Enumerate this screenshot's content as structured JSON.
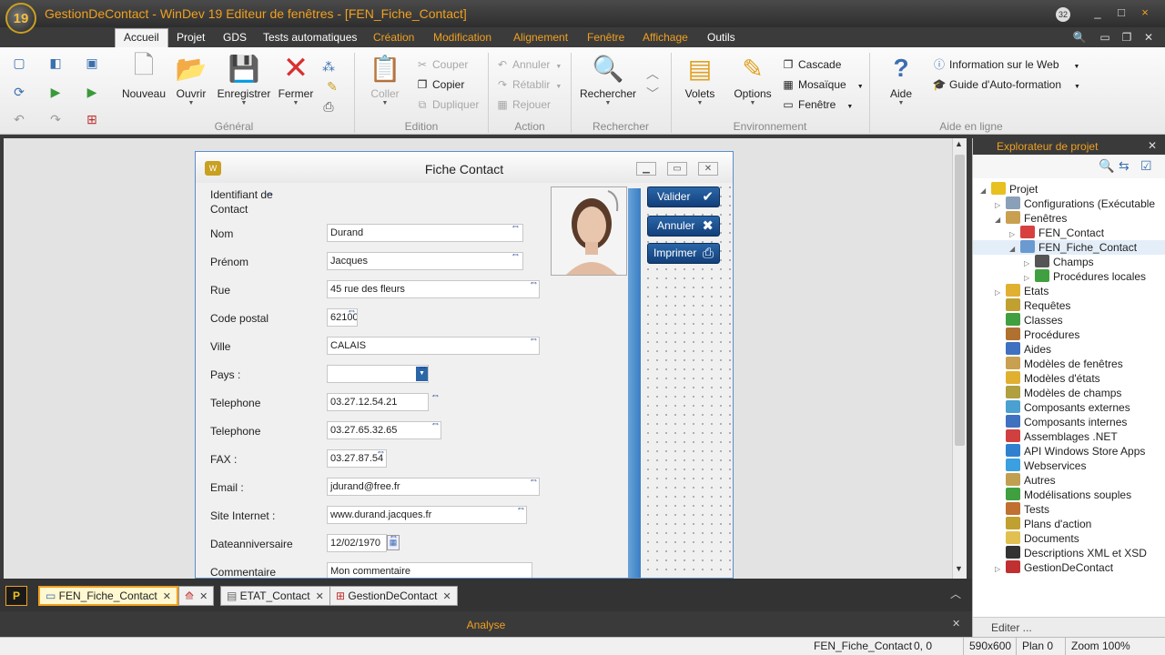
{
  "app": {
    "logo_text": "19",
    "title": "GestionDeContact - WinDev 19  Editeur de fenêtres - [FEN_Fiche_Contact]",
    "notif_count": "32",
    "win_controls": [
      "_",
      "□",
      "×"
    ]
  },
  "menu": {
    "items": [
      "Accueil",
      "Projet",
      "GDS",
      "Tests automatiques",
      "Création",
      "Modification",
      "Alignement",
      "Fenêtre",
      "Affichage",
      "Outils"
    ]
  },
  "ribbon": {
    "groups": [
      "Général",
      "Edition",
      "Action",
      "Rechercher",
      "Environnement",
      "Aide en ligne"
    ],
    "general": {
      "nouveau": "Nouveau",
      "ouvrir": "Ouvrir",
      "enregistrer": "Enregistrer",
      "fermer": "Fermer"
    },
    "edition": {
      "coller": "Coller",
      "couper": "Couper",
      "copier": "Copier",
      "dupliquer": "Dupliquer"
    },
    "action": {
      "annuler": "Annuler",
      "retablir": "Rétablir",
      "rejouer": "Rejouer"
    },
    "rechercher": {
      "label": "Rechercher"
    },
    "environnement": {
      "volets": "Volets",
      "options": "Options",
      "cascade": "Cascade",
      "mosaique": "Mosaïque",
      "fenetre": "Fenêtre"
    },
    "aide": {
      "aide": "Aide",
      "info_web": "Information sur le Web",
      "guide": "Guide d'Auto-formation"
    }
  },
  "form": {
    "title": "Fiche Contact",
    "fields": [
      {
        "label": "Identifiant de\nContact",
        "value": ""
      },
      {
        "label": "Nom",
        "value": "Durand"
      },
      {
        "label": "Prénom",
        "value": "Jacques"
      },
      {
        "label": "Rue",
        "value": "45 rue des fleurs"
      },
      {
        "label": "Code postal",
        "value": "62100"
      },
      {
        "label": "Ville",
        "value": "CALAIS"
      },
      {
        "label": "Pays :",
        "value": ""
      },
      {
        "label": "Telephone",
        "value": "03.27.12.54.21"
      },
      {
        "label": "Telephone",
        "value": "03.27.65.32.65"
      },
      {
        "label": "FAX :",
        "value": "03.27.87.54"
      },
      {
        "label": "Email :",
        "value": "jdurand@free.fr"
      },
      {
        "label": "Site Internet :",
        "value": "www.durand.jacques.fr"
      },
      {
        "label": "Dateanniversaire",
        "value": "12/02/1970"
      },
      {
        "label": "Commentaire",
        "value": "Mon commentaire"
      }
    ],
    "buttons": {
      "valider": "Valider",
      "annuler": "Annuler",
      "imprimer": "Imprimer"
    }
  },
  "project_explorer": {
    "title": "Explorateur de projet",
    "footer": "Editer ...",
    "tree": [
      {
        "label": "Projet",
        "depth": 0,
        "expanded": "open",
        "color": "#e8c020"
      },
      {
        "label": "Configurations (Exécutable",
        "depth": 1,
        "expanded": "closed",
        "color": "#8a9fb8"
      },
      {
        "label": "Fenêtres",
        "depth": 1,
        "expanded": "open",
        "color": "#c8a050"
      },
      {
        "label": "FEN_Contact",
        "depth": 2,
        "expanded": "closed",
        "color": "#d84040"
      },
      {
        "label": "FEN_Fiche_Contact",
        "depth": 2,
        "expanded": "open",
        "color": "#6a9ad0",
        "selected": true
      },
      {
        "label": "Champs",
        "depth": 3,
        "expanded": "closed",
        "color": "#555555"
      },
      {
        "label": "Procédures locales",
        "depth": 3,
        "expanded": "closed",
        "color": "#40a040"
      },
      {
        "label": "Etats",
        "depth": 1,
        "expanded": "closed",
        "color": "#e0b030"
      },
      {
        "label": "Requêtes",
        "depth": 1,
        "expanded": "",
        "color": "#c0a030"
      },
      {
        "label": "Classes",
        "depth": 1,
        "expanded": "",
        "color": "#40a040"
      },
      {
        "label": "Procédures",
        "depth": 1,
        "expanded": "",
        "color": "#b07030"
      },
      {
        "label": "Aides",
        "depth": 1,
        "expanded": "",
        "color": "#4070c0"
      },
      {
        "label": "Modèles de fenêtres",
        "depth": 1,
        "expanded": "",
        "color": "#c8a050"
      },
      {
        "label": "Modèles d'états",
        "depth": 1,
        "expanded": "",
        "color": "#e0b030"
      },
      {
        "label": "Modèles de champs",
        "depth": 1,
        "expanded": "",
        "color": "#b0a040"
      },
      {
        "label": "Composants externes",
        "depth": 1,
        "expanded": "",
        "color": "#4aa0d0"
      },
      {
        "label": "Composants internes",
        "depth": 1,
        "expanded": "",
        "color": "#4070c0"
      },
      {
        "label": "Assemblages .NET",
        "depth": 1,
        "expanded": "",
        "color": "#d04040"
      },
      {
        "label": "API Windows Store Apps",
        "depth": 1,
        "expanded": "",
        "color": "#3080d0"
      },
      {
        "label": "Webservices",
        "depth": 1,
        "expanded": "",
        "color": "#3aa0e0"
      },
      {
        "label": "Autres",
        "depth": 1,
        "expanded": "",
        "color": "#c0a050"
      },
      {
        "label": "Modélisations souples",
        "depth": 1,
        "expanded": "",
        "color": "#40a040"
      },
      {
        "label": "Tests",
        "depth": 1,
        "expanded": "",
        "color": "#c07030"
      },
      {
        "label": "Plans d'action",
        "depth": 1,
        "expanded": "",
        "color": "#c0a030"
      },
      {
        "label": "Documents",
        "depth": 1,
        "expanded": "",
        "color": "#e0c050"
      },
      {
        "label": "Descriptions XML et XSD",
        "depth": 1,
        "expanded": "",
        "color": "#333333"
      },
      {
        "label": "GestionDeContact",
        "depth": 1,
        "expanded": "closed",
        "color": "#c03030"
      }
    ]
  },
  "tabs": [
    {
      "label": "FEN_Fiche_Contact",
      "active": true
    },
    {
      "label": "",
      "active": false
    },
    {
      "label": "ETAT_Contact",
      "active": false
    },
    {
      "label": "GestionDeContact",
      "active": false
    }
  ],
  "analyse_bar": "Analyse",
  "statusbar": {
    "window": "FEN_Fiche_Contact",
    "coords": "0, 0",
    "size": "590x600",
    "plan": "Plan 0",
    "zoom": "Zoom 100%"
  }
}
